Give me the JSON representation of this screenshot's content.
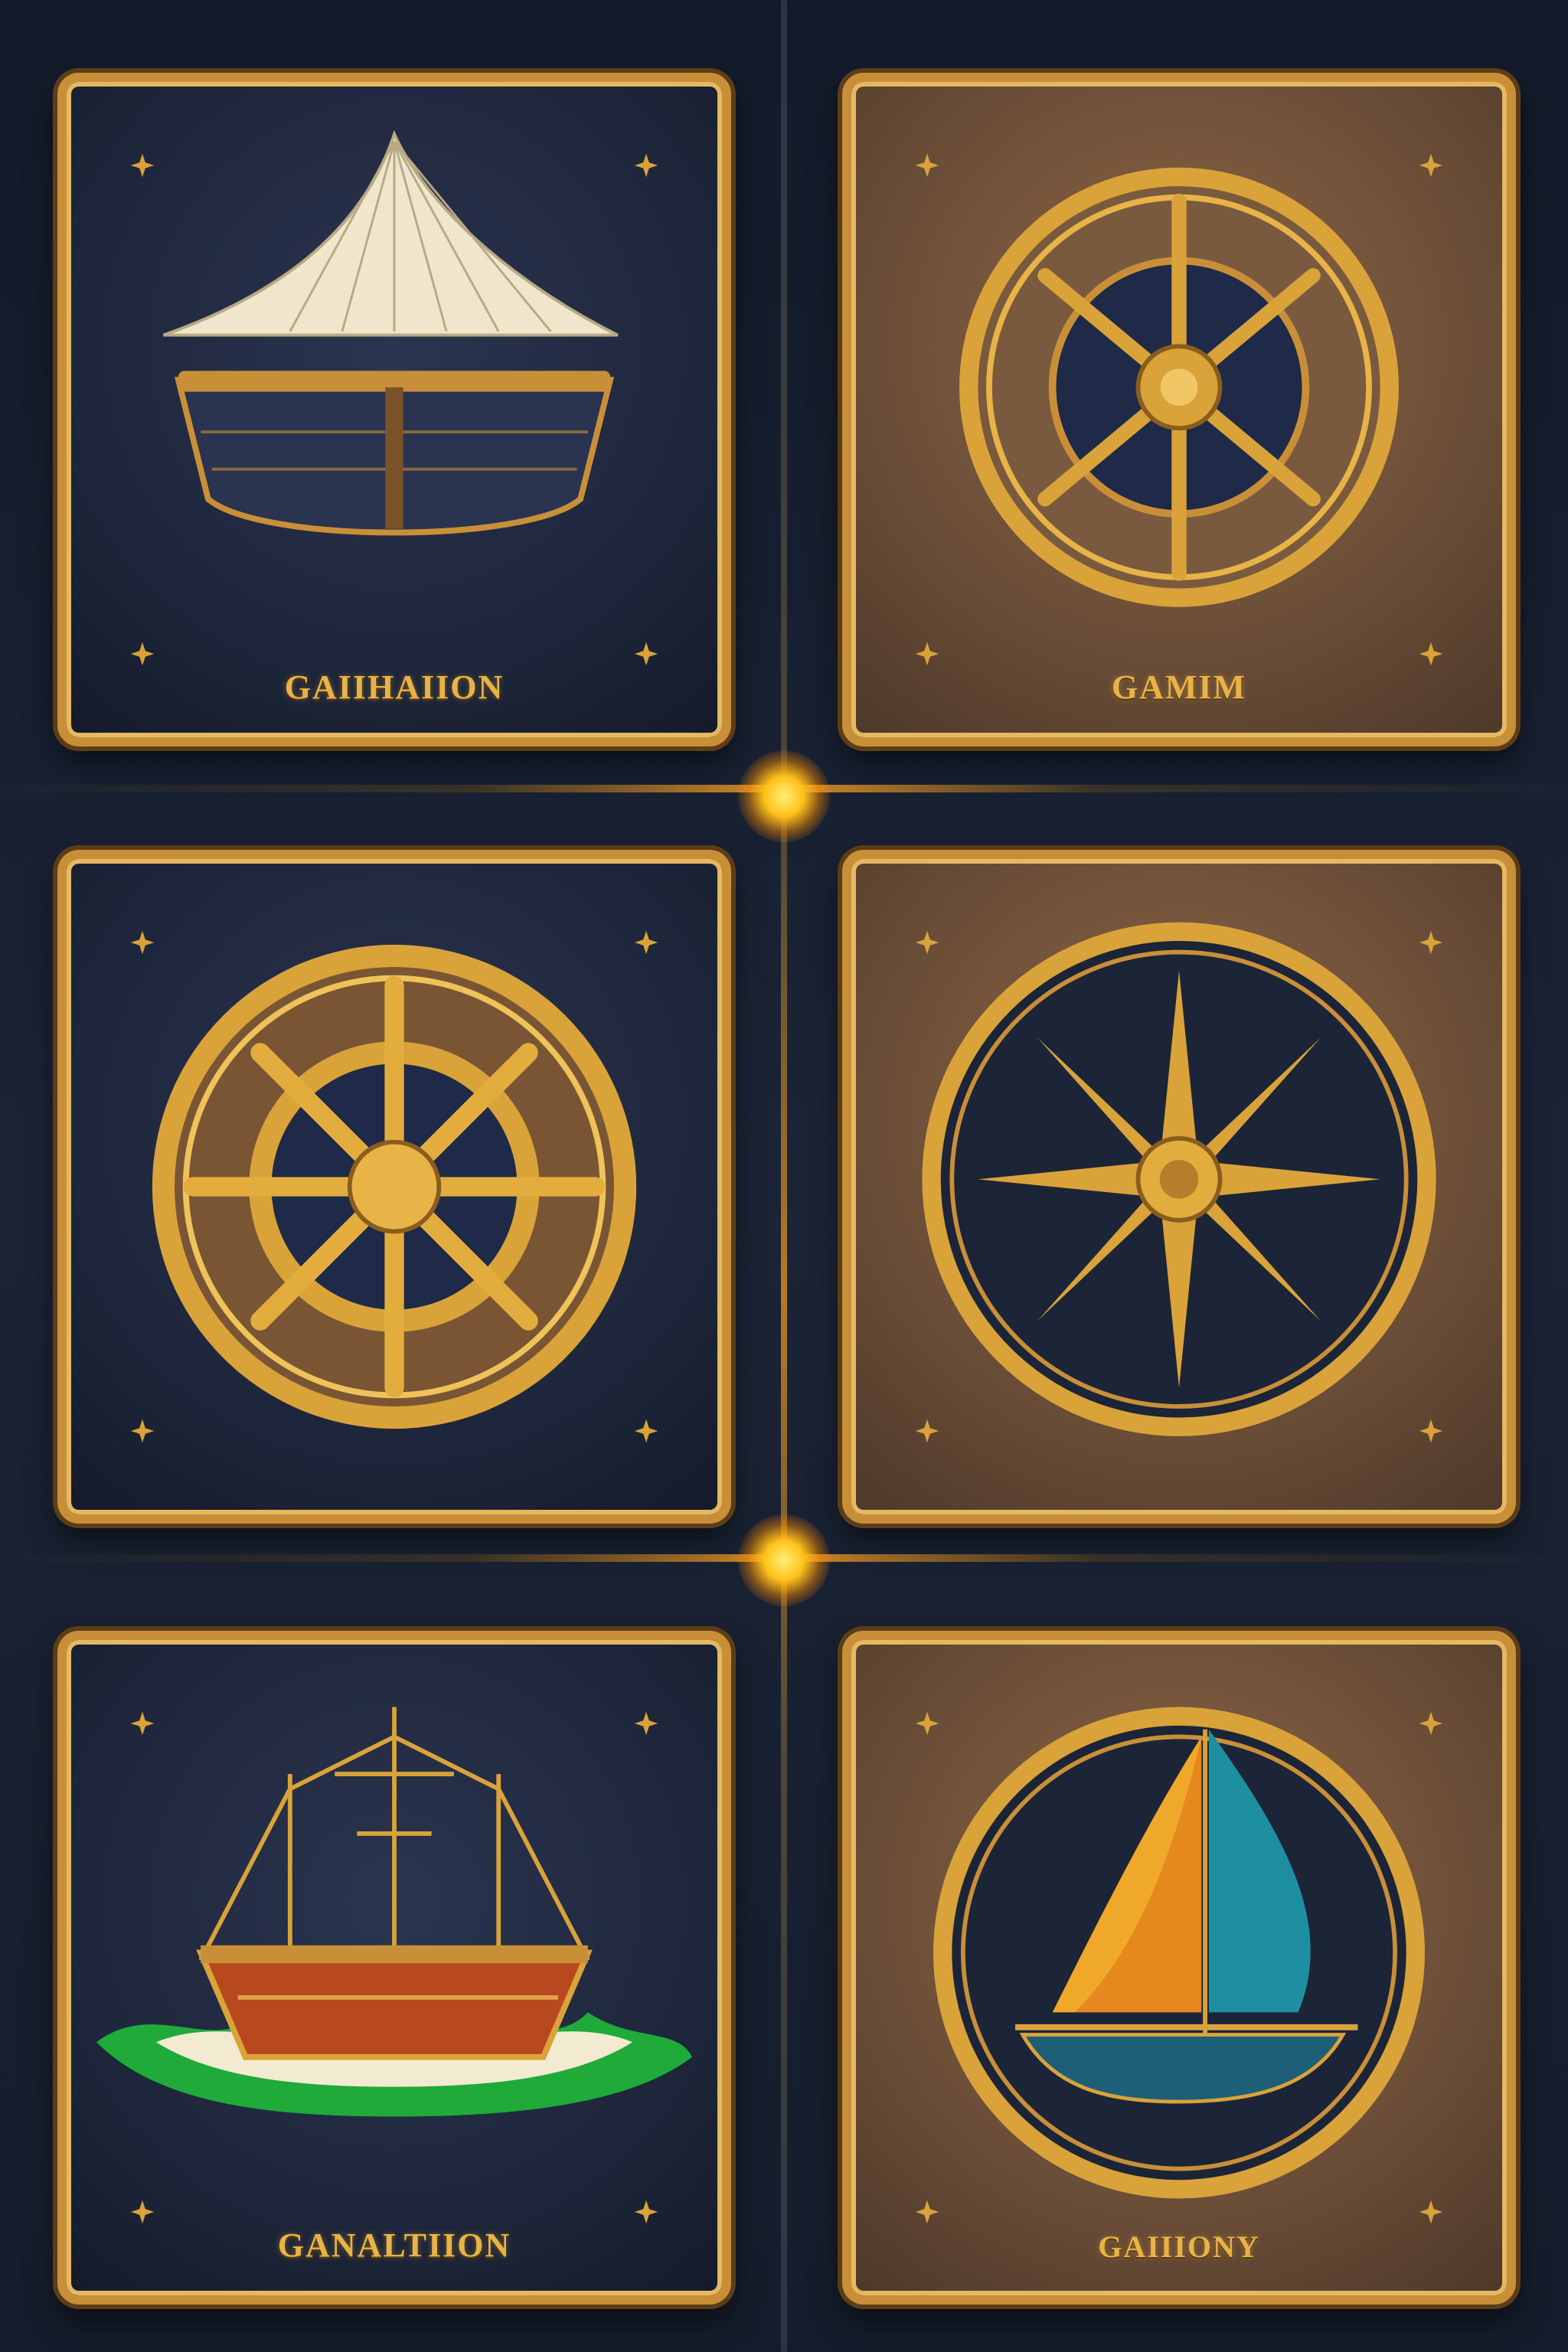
{
  "tiles": [
    {
      "label": "GAIIHAIION",
      "emblem": "sailboat-icon",
      "theme": "dark"
    },
    {
      "label": "GAMIM",
      "emblem": "ship-wheel-compass-icon",
      "theme": "brown"
    },
    {
      "label": "",
      "emblem": "ship-wheel-icon",
      "theme": "dark"
    },
    {
      "label": "",
      "emblem": "compass-rose-icon",
      "theme": "brown"
    },
    {
      "label": "GANALTIION",
      "emblem": "galleon-icon",
      "theme": "dark"
    },
    {
      "label": "GAIIIONY",
      "emblem": "sailing-yacht-icon",
      "theme": "brown"
    }
  ],
  "colors": {
    "gold": "#d9a33a",
    "navy": "#1c2438",
    "brown": "#6a4d37",
    "glow": "#ffc21a"
  }
}
